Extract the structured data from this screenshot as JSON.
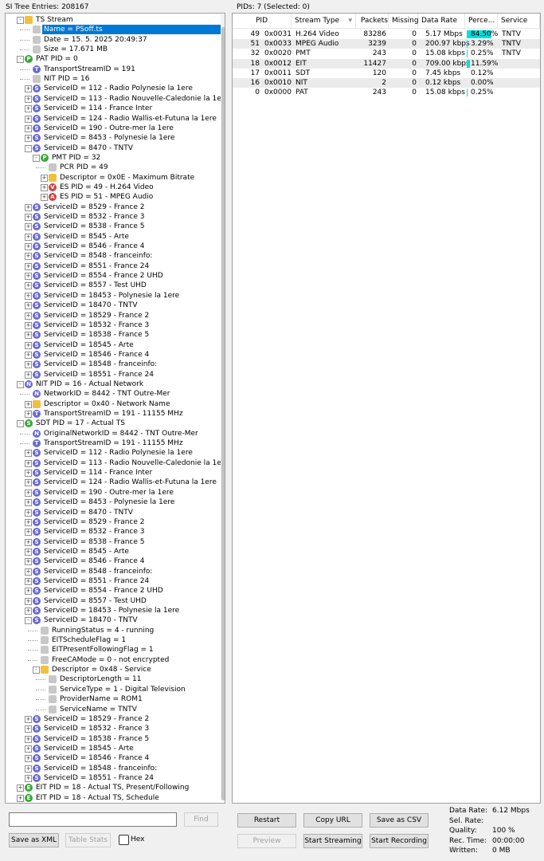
{
  "tree_header": "SI Tree Entries: 208167",
  "pids_header": "PIDs: 7   (Selected: 0)",
  "tree": [
    {
      "level": 0,
      "exp": "-",
      "icon": "folder",
      "text": "TS Stream"
    },
    {
      "level": 1,
      "exp": "",
      "icon": "doc",
      "text": "Name = PSoff.ts",
      "selected": true
    },
    {
      "level": 1,
      "exp": "",
      "icon": "doc",
      "text": "Date = 15. 5. 2025 20:49:37"
    },
    {
      "level": 1,
      "exp": "",
      "icon": "doc",
      "text": "Size = 17.671 MB"
    },
    {
      "level": 0,
      "exp": "-",
      "icon": "P",
      "text": "PAT PID = 0"
    },
    {
      "level": 1,
      "exp": "",
      "icon": "T",
      "text": "TransportStreamID = 191"
    },
    {
      "level": 1,
      "exp": "",
      "icon": "doc",
      "text": "NIT PID = 16"
    },
    {
      "level": 1,
      "exp": "+",
      "icon": "S",
      "text": "ServiceID = 112 - Radio Polynesie la 1ere"
    },
    {
      "level": 1,
      "exp": "+",
      "icon": "S",
      "text": "ServiceID = 113 - Radio Nouvelle-Caledonie la 1ere"
    },
    {
      "level": 1,
      "exp": "+",
      "icon": "S",
      "text": "ServiceID = 114 - France Inter"
    },
    {
      "level": 1,
      "exp": "+",
      "icon": "S",
      "text": "ServiceID = 124 - Radio Wallis-et-Futuna la 1ere"
    },
    {
      "level": 1,
      "exp": "+",
      "icon": "S",
      "text": "ServiceID = 190 - Outre-mer la 1ere"
    },
    {
      "level": 1,
      "exp": "+",
      "icon": "S",
      "text": "ServiceID = 8453 - Polynesie la 1ere"
    },
    {
      "level": 1,
      "exp": "-",
      "icon": "S",
      "text": "ServiceID = 8470 - TNTV"
    },
    {
      "level": 2,
      "exp": "-",
      "icon": "P",
      "text": "PMT PID = 32"
    },
    {
      "level": 3,
      "exp": "",
      "icon": "doc",
      "text": "PCR PID = 49"
    },
    {
      "level": 3,
      "exp": "+",
      "icon": "folder",
      "text": "Descriptor = 0x0E - Maximum Bitrate"
    },
    {
      "level": 3,
      "exp": "+",
      "icon": "V",
      "text": "ES PID = 49 - H.264 Video"
    },
    {
      "level": 3,
      "exp": "+",
      "icon": "A",
      "text": "ES PID = 51 - MPEG Audio"
    },
    {
      "level": 1,
      "exp": "+",
      "icon": "S",
      "text": "ServiceID = 8529 - France 2"
    },
    {
      "level": 1,
      "exp": "+",
      "icon": "S",
      "text": "ServiceID = 8532 - France 3"
    },
    {
      "level": 1,
      "exp": "+",
      "icon": "S",
      "text": "ServiceID = 8538 - France 5"
    },
    {
      "level": 1,
      "exp": "+",
      "icon": "S",
      "text": "ServiceID = 8545 - Arte"
    },
    {
      "level": 1,
      "exp": "+",
      "icon": "S",
      "text": "ServiceID = 8546 - France 4"
    },
    {
      "level": 1,
      "exp": "+",
      "icon": "S",
      "text": "ServiceID = 8548 - franceinfo:"
    },
    {
      "level": 1,
      "exp": "+",
      "icon": "S",
      "text": "ServiceID = 8551 - France 24"
    },
    {
      "level": 1,
      "exp": "+",
      "icon": "S",
      "text": "ServiceID = 8554 - France 2 UHD"
    },
    {
      "level": 1,
      "exp": "+",
      "icon": "S",
      "text": "ServiceID = 8557 - Test UHD"
    },
    {
      "level": 1,
      "exp": "+",
      "icon": "S",
      "text": "ServiceID = 18453 - Polynesie la 1ere"
    },
    {
      "level": 1,
      "exp": "+",
      "icon": "S",
      "text": "ServiceID = 18470 - TNTV"
    },
    {
      "level": 1,
      "exp": "+",
      "icon": "S",
      "text": "ServiceID = 18529 - France 2"
    },
    {
      "level": 1,
      "exp": "+",
      "icon": "S",
      "text": "ServiceID = 18532 - France 3"
    },
    {
      "level": 1,
      "exp": "+",
      "icon": "S",
      "text": "ServiceID = 18538 - France 5"
    },
    {
      "level": 1,
      "exp": "+",
      "icon": "S",
      "text": "ServiceID = 18545 - Arte"
    },
    {
      "level": 1,
      "exp": "+",
      "icon": "S",
      "text": "ServiceID = 18546 - France 4"
    },
    {
      "level": 1,
      "exp": "+",
      "icon": "S",
      "text": "ServiceID = 18548 - franceinfo:"
    },
    {
      "level": 1,
      "exp": "+",
      "icon": "S",
      "text": "ServiceID = 18551 - France 24"
    },
    {
      "level": 0,
      "exp": "-",
      "icon": "N",
      "text": "NIT PID = 16 - Actual Network"
    },
    {
      "level": 1,
      "exp": "",
      "icon": "N",
      "text": "NetworkID = 8442 - TNT Outre-Mer"
    },
    {
      "level": 1,
      "exp": "+",
      "icon": "folder",
      "text": "Descriptor = 0x40 - Network Name"
    },
    {
      "level": 1,
      "exp": "+",
      "icon": "T",
      "text": "TransportStreamID = 191 - 11155 MHz"
    },
    {
      "level": 0,
      "exp": "-",
      "icon": "S2",
      "text": "SDT PID = 17 - Actual TS"
    },
    {
      "level": 1,
      "exp": "",
      "icon": "N",
      "text": "OriginalNetworkID = 8442 - TNT Outre-Mer"
    },
    {
      "level": 1,
      "exp": "",
      "icon": "T",
      "text": "TransportStreamID = 191 - 11155 MHz"
    },
    {
      "level": 1,
      "exp": "+",
      "icon": "S",
      "text": "ServiceID = 112 - Radio Polynesie la 1ere"
    },
    {
      "level": 1,
      "exp": "+",
      "icon": "S",
      "text": "ServiceID = 113 - Radio Nouvelle-Caledonie la 1ere"
    },
    {
      "level": 1,
      "exp": "+",
      "icon": "S",
      "text": "ServiceID = 114 - France Inter"
    },
    {
      "level": 1,
      "exp": "+",
      "icon": "S",
      "text": "ServiceID = 124 - Radio Wallis-et-Futuna la 1ere"
    },
    {
      "level": 1,
      "exp": "+",
      "icon": "S",
      "text": "ServiceID = 190 - Outre-mer la 1ere"
    },
    {
      "level": 1,
      "exp": "+",
      "icon": "S",
      "text": "ServiceID = 8453 - Polynesie la 1ere"
    },
    {
      "level": 1,
      "exp": "+",
      "icon": "S",
      "text": "ServiceID = 8470 - TNTV"
    },
    {
      "level": 1,
      "exp": "+",
      "icon": "S",
      "text": "ServiceID = 8529 - France 2"
    },
    {
      "level": 1,
      "exp": "+",
      "icon": "S",
      "text": "ServiceID = 8532 - France 3"
    },
    {
      "level": 1,
      "exp": "+",
      "icon": "S",
      "text": "ServiceID = 8538 - France 5"
    },
    {
      "level": 1,
      "exp": "+",
      "icon": "S",
      "text": "ServiceID = 8545 - Arte"
    },
    {
      "level": 1,
      "exp": "+",
      "icon": "S",
      "text": "ServiceID = 8546 - France 4"
    },
    {
      "level": 1,
      "exp": "+",
      "icon": "S",
      "text": "ServiceID = 8548 - franceinfo:"
    },
    {
      "level": 1,
      "exp": "+",
      "icon": "S",
      "text": "ServiceID = 8551 - France 24"
    },
    {
      "level": 1,
      "exp": "+",
      "icon": "S",
      "text": "ServiceID = 8554 - France 2 UHD"
    },
    {
      "level": 1,
      "exp": "+",
      "icon": "S",
      "text": "ServiceID = 8557 - Test UHD"
    },
    {
      "level": 1,
      "exp": "+",
      "icon": "S",
      "text": "ServiceID = 18453 - Polynesie la 1ere"
    },
    {
      "level": 1,
      "exp": "-",
      "icon": "S",
      "text": "ServiceID = 18470 - TNTV"
    },
    {
      "level": 2,
      "exp": "",
      "icon": "doc",
      "text": "RunningStatus = 4 - running"
    },
    {
      "level": 2,
      "exp": "",
      "icon": "doc",
      "text": "EITScheduleFlag = 1"
    },
    {
      "level": 2,
      "exp": "",
      "icon": "doc",
      "text": "EITPresentFollowingFlag = 1"
    },
    {
      "level": 2,
      "exp": "",
      "icon": "doc",
      "text": "FreeCAMode = 0 - not encrypted"
    },
    {
      "level": 2,
      "exp": "-",
      "icon": "folder",
      "text": "Descriptor = 0x48 - Service"
    },
    {
      "level": 3,
      "exp": "",
      "icon": "doc",
      "text": "DescriptorLength = 11"
    },
    {
      "level": 3,
      "exp": "",
      "icon": "doc",
      "text": "ServiceType = 1 - Digital Television"
    },
    {
      "level": 3,
      "exp": "",
      "icon": "doc",
      "text": "ProviderName = ROM1"
    },
    {
      "level": 3,
      "exp": "",
      "icon": "doc",
      "text": "ServiceName = TNTV"
    },
    {
      "level": 1,
      "exp": "+",
      "icon": "S",
      "text": "ServiceID = 18529 - France 2"
    },
    {
      "level": 1,
      "exp": "+",
      "icon": "S",
      "text": "ServiceID = 18532 - France 3"
    },
    {
      "level": 1,
      "exp": "+",
      "icon": "S",
      "text": "ServiceID = 18538 - France 5"
    },
    {
      "level": 1,
      "exp": "+",
      "icon": "S",
      "text": "ServiceID = 18545 - Arte"
    },
    {
      "level": 1,
      "exp": "+",
      "icon": "S",
      "text": "ServiceID = 18546 - France 4"
    },
    {
      "level": 1,
      "exp": "+",
      "icon": "S",
      "text": "ServiceID = 18548 - franceinfo:"
    },
    {
      "level": 1,
      "exp": "+",
      "icon": "S",
      "text": "ServiceID = 18551 - France 24"
    },
    {
      "level": 0,
      "exp": "+",
      "icon": "E",
      "text": "EIT PID = 18 - Actual TS, Present/Following"
    },
    {
      "level": 0,
      "exp": "+",
      "icon": "E",
      "text": "EIT PID = 18 - Actual TS, Schedule"
    }
  ],
  "icon_colors": {
    "folder": "#f0c040",
    "doc": "#c8c8c8",
    "P": "#3aa63a",
    "S": "#6a6ad0",
    "S2": "#3aa63a",
    "T": "#6a6ad0",
    "N": "#6a6ad0",
    "V": "#d04040",
    "A": "#d04040",
    "E": "#3aa63a"
  },
  "search": {
    "placeholder": "",
    "value": ""
  },
  "buttons": {
    "find": "Find",
    "save_xml": "Save as XML",
    "table_stats": "Table Stats",
    "hex": "Hex",
    "restart": "Restart",
    "copy_url": "Copy URL",
    "save_csv": "Save as CSV",
    "preview": "Preview",
    "start_streaming": "Start Streaming",
    "start_recording": "Start Recording"
  },
  "pid_columns": [
    "PID",
    "Stream Type",
    "Packets",
    "Missing",
    "Data Rate",
    "Perce...",
    "Service"
  ],
  "pid_rows": [
    {
      "pid": "49",
      "hex": "0x0031",
      "type": "H.264 Video",
      "packets": "83286",
      "missing": "0",
      "rate": "5.17 Mbps",
      "pct": "84.50%",
      "pct_value": 84.5,
      "service": "TNTV"
    },
    {
      "pid": "51",
      "hex": "0x0033",
      "type": "MPEG Audio",
      "packets": "3239",
      "missing": "0",
      "rate": "200.97 kbps",
      "pct": "3.29%",
      "pct_value": 3.29,
      "service": "TNTV"
    },
    {
      "pid": "32",
      "hex": "0x0020",
      "type": "PMT",
      "packets": "243",
      "missing": "0",
      "rate": "15.08 kbps",
      "pct": "0.25%",
      "pct_value": 0.25,
      "service": "TNTV"
    },
    {
      "pid": "18",
      "hex": "0x0012",
      "type": "EIT",
      "packets": "11427",
      "missing": "0",
      "rate": "709.00 kbps",
      "pct": "11.59%",
      "pct_value": 11.59,
      "service": ""
    },
    {
      "pid": "17",
      "hex": "0x0011",
      "type": "SDT",
      "packets": "120",
      "missing": "0",
      "rate": "7.45 kbps",
      "pct": "0.12%",
      "pct_value": 0.12,
      "service": ""
    },
    {
      "pid": "16",
      "hex": "0x0010",
      "type": "NIT",
      "packets": "2",
      "missing": "0",
      "rate": "0.12 kbps",
      "pct": "0.00%",
      "pct_value": 0.0,
      "service": ""
    },
    {
      "pid": "0",
      "hex": "0x0000",
      "type": "PAT",
      "packets": "243",
      "missing": "0",
      "rate": "15.08 kbps",
      "pct": "0.25%",
      "pct_value": 0.25,
      "service": ""
    }
  ],
  "stats": [
    {
      "label": "Data Rate:",
      "value": "6.12 Mbps"
    },
    {
      "label": "Sel. Rate:",
      "value": ""
    },
    {
      "label": "Quality:",
      "value": "100 %"
    },
    {
      "label": "Rec. Time:",
      "value": "00:00:00"
    },
    {
      "label": "Written:",
      "value": "0 MB"
    }
  ],
  "colors": {
    "selection": "#0078d7",
    "percent_bar": "#00e0e0"
  }
}
